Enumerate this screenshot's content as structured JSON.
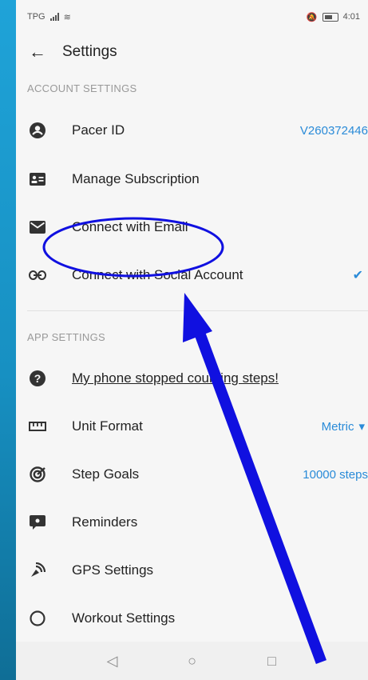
{
  "status": {
    "carrier": "TPG",
    "time": "4:01"
  },
  "header": {
    "back_icon": "arrow-left-icon",
    "title": "Settings"
  },
  "account": {
    "heading": "ACCOUNT SETTINGS",
    "items": [
      {
        "label": "Pacer ID",
        "value": "V260372446",
        "icon": "account-circle-icon"
      },
      {
        "label": "Manage Subscription",
        "icon": "id-card-icon"
      },
      {
        "label": "Connect with Email",
        "icon": "email-icon"
      },
      {
        "label": "Connect with Social Account",
        "icon": "link-icon",
        "checked": true
      }
    ]
  },
  "app": {
    "heading": "APP SETTINGS",
    "items": [
      {
        "label": "My phone stopped counting steps!",
        "icon": "help-circle-icon"
      },
      {
        "label": "Unit Format",
        "value": "Metric",
        "icon": "ruler-icon"
      },
      {
        "label": "Step Goals",
        "value": "10000 steps",
        "icon": "target-icon"
      },
      {
        "label": "Reminders",
        "icon": "reminder-icon"
      },
      {
        "label": "GPS Settings",
        "icon": "gps-icon"
      },
      {
        "label": "Workout Settings",
        "icon": "workout-icon"
      }
    ]
  },
  "colors": {
    "accent": "#2a8bd8",
    "annotation": "#1010e0",
    "background": "#1fa3d8"
  }
}
